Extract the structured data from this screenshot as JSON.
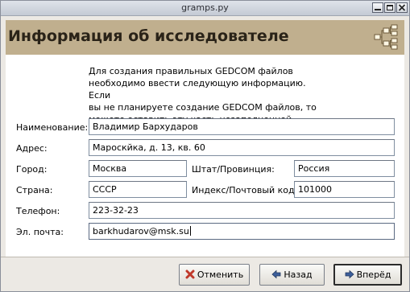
{
  "window": {
    "title": "gramps.py"
  },
  "header": {
    "title": "Информация об исследователе",
    "icon": "family-tree-icon"
  },
  "intro_text": "Для создания правильных GEDCOM файлов\nнеобходимо ввести следующую информацию. Если\nвы не планируете создание GEDCOM файлов, то\nможете оставить эту часть незаполненной.",
  "form": {
    "name_label": "Наименование:",
    "name_value": "Владимир Бархударов",
    "address_label": "Адрес:",
    "address_value": "Мароскйка, д. 13, кв. 60",
    "city_label": "Город:",
    "city_value": "Москва",
    "state_label": "Штат/Провинция:",
    "state_value": "Россия",
    "country_label": "Страна:",
    "country_value": "СССР",
    "zip_label": "Индекс/Почтовый код:",
    "zip_value": "101000",
    "phone_label": "Телефон:",
    "phone_value": "223-32-23",
    "email_label": "Эл. почта:",
    "email_value": "barkhudarov@msk.su"
  },
  "buttons": {
    "cancel": "Отменить",
    "back": "Назад",
    "forward": "Вперёд"
  },
  "colors": {
    "header_band": "#c0af8e",
    "cancel_icon": "#c0392b",
    "nav_icon": "#3d5f9c"
  }
}
